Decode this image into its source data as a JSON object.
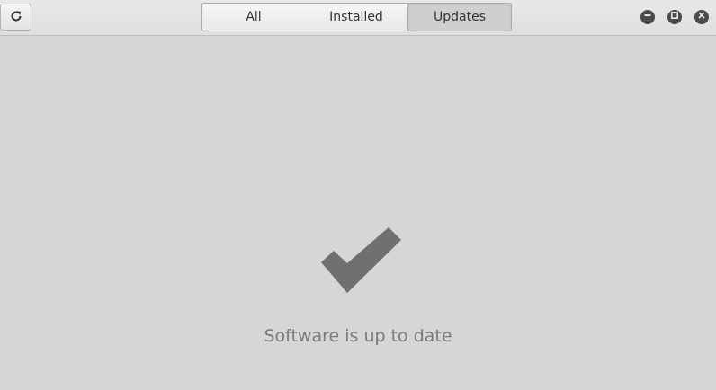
{
  "header": {
    "refresh_icon": "refresh-icon",
    "tabs": [
      {
        "label": "All",
        "active": false
      },
      {
        "label": "Installed",
        "active": false
      },
      {
        "label": "Updates",
        "active": true
      }
    ],
    "window_controls": [
      "minimize-icon",
      "maximize-icon",
      "close-icon"
    ]
  },
  "main": {
    "status_icon": "checkmark-icon",
    "status_text": "Software is up to date"
  },
  "colors": {
    "background": "#d6d6d6",
    "check": "#707070",
    "text": "#7a7a7a"
  }
}
